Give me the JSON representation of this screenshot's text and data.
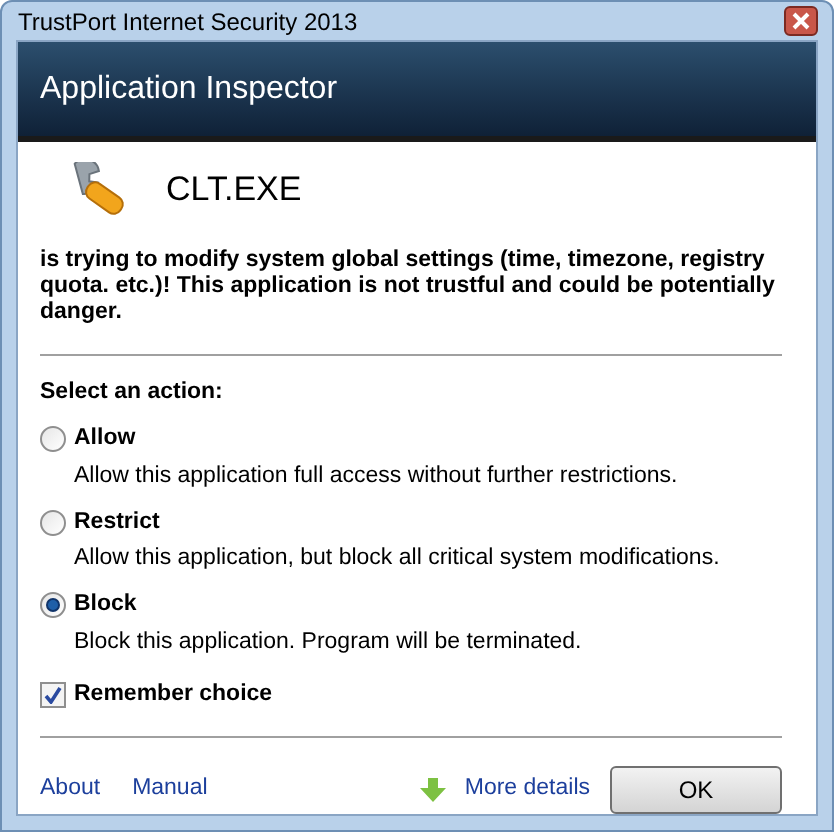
{
  "window": {
    "title": "TrustPort Internet Security 2013"
  },
  "header": {
    "title": "Application Inspector"
  },
  "application": {
    "name": "CLT.EXE",
    "message": "is trying to modify system global settings (time, timezone, registry quota. etc.)! This application is not trustful and could be potentially danger."
  },
  "action_heading": "Select an action:",
  "actions": [
    {
      "label": "Allow",
      "description": "Allow this application full access without further restrictions.",
      "selected": false
    },
    {
      "label": "Restrict",
      "description": "Allow this application, but block all critical system modifications.",
      "selected": false
    },
    {
      "label": "Block",
      "description": "Block this application. Program will be terminated.",
      "selected": true
    }
  ],
  "remember": {
    "label": "Remember choice",
    "checked": true
  },
  "links": [
    "About",
    "Manual"
  ],
  "more_details": "More details",
  "ok_button": "OK"
}
